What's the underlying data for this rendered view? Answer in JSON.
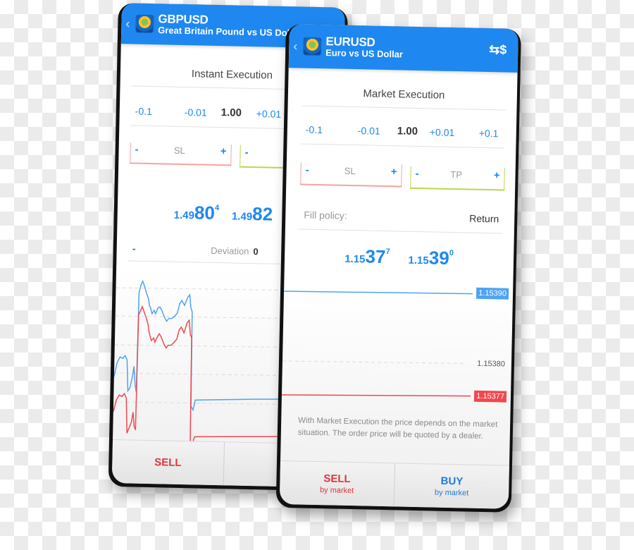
{
  "back_phone": {
    "header": {
      "symbol": "GBPUSD",
      "description": "Great Britain Pound vs US Dollar"
    },
    "execution_type": "Instant Execution",
    "volume": {
      "minus_big": "-0.1",
      "minus_small": "-0.01",
      "value": "1.00",
      "plus_small": "+0.01"
    },
    "sl": {
      "minus": "-",
      "label": "SL",
      "plus": "+"
    },
    "tp": {
      "minus": "-"
    },
    "quotes": {
      "bid": {
        "prefix": "1.49",
        "big": "80",
        "sup": "4"
      },
      "ask": {
        "prefix": "1.49",
        "big": "82",
        "sup": ""
      }
    },
    "deviation": {
      "minus": "-",
      "label": "Deviation",
      "value": "0"
    },
    "footer": {
      "sell_label": "SELL"
    },
    "colors": {
      "ask": "#4da3f5",
      "bid": "#f0484e"
    }
  },
  "front_phone": {
    "header": {
      "symbol": "EURUSD",
      "description": "Euro vs US Dollar",
      "trade_icon": "currency-exchange-icon"
    },
    "execution_type": "Market Execution",
    "volume": {
      "minus_big": "-0.1",
      "minus_small": "-0.01",
      "value": "1.00",
      "plus_small": "+0.01",
      "plus_big": "+0.1"
    },
    "sl": {
      "minus": "-",
      "label": "SL",
      "plus": "+"
    },
    "tp": {
      "minus": "-",
      "label": "TP",
      "plus": "+"
    },
    "fill_policy": {
      "label": "Fill policy:",
      "value": "Return"
    },
    "quotes": {
      "bid": {
        "prefix": "1.15",
        "big": "37",
        "sup": "7"
      },
      "ask": {
        "prefix": "1.15",
        "big": "39",
        "sup": "0"
      }
    },
    "chart": {
      "ask_price": "1.15390",
      "grid_price": "1.15380",
      "bid_price": "1.15377"
    },
    "notice": "With Market Execution the price depends on the market situation. The order price will be quoted by a dealer.",
    "footer": {
      "sell_label": "SELL",
      "sell_sub": "by market",
      "buy_label": "BUY",
      "buy_sub": "by market"
    },
    "colors": {
      "header": "#1e88f0",
      "ask": "#4da3f5",
      "bid": "#f0484e",
      "sl_border": "#f5a3a3",
      "tp_border": "#b6d94c"
    }
  }
}
